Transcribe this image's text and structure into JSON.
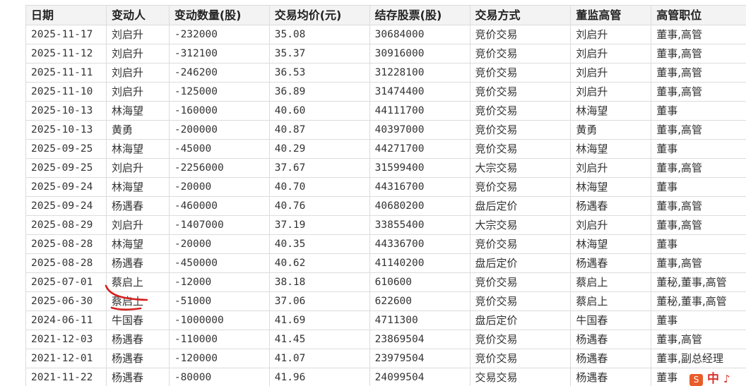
{
  "table": {
    "headers": [
      "日期",
      "变动人",
      "变动数量(股)",
      "交易均价(元)",
      "结存股票(股)",
      "交易方式",
      "董监高管",
      "高管职位"
    ],
    "rows": [
      [
        "2025-11-17",
        "刘启升",
        "-232000",
        "35.08",
        "30684000",
        "竞价交易",
        "刘启升",
        "董事,高管"
      ],
      [
        "2025-11-12",
        "刘启升",
        "-312100",
        "35.37",
        "30916000",
        "竞价交易",
        "刘启升",
        "董事,高管"
      ],
      [
        "2025-11-11",
        "刘启升",
        "-246200",
        "36.53",
        "31228100",
        "竞价交易",
        "刘启升",
        "董事,高管"
      ],
      [
        "2025-11-10",
        "刘启升",
        "-125000",
        "36.89",
        "31474400",
        "竞价交易",
        "刘启升",
        "董事,高管"
      ],
      [
        "2025-10-13",
        "林海望",
        "-160000",
        "40.60",
        "44111700",
        "竞价交易",
        "林海望",
        "董事"
      ],
      [
        "2025-10-13",
        "黄勇",
        "-200000",
        "40.87",
        "40397000",
        "竞价交易",
        "黄勇",
        "董事,高管"
      ],
      [
        "2025-09-25",
        "林海望",
        "-45000",
        "40.29",
        "44271700",
        "竞价交易",
        "林海望",
        "董事"
      ],
      [
        "2025-09-25",
        "刘启升",
        "-2256000",
        "37.67",
        "31599400",
        "大宗交易",
        "刘启升",
        "董事,高管"
      ],
      [
        "2025-09-24",
        "林海望",
        "-20000",
        "40.70",
        "44316700",
        "竞价交易",
        "林海望",
        "董事"
      ],
      [
        "2025-09-24",
        "杨遇春",
        "-460000",
        "40.76",
        "40680200",
        "盘后定价",
        "杨遇春",
        "董事,高管"
      ],
      [
        "2025-08-29",
        "刘启升",
        "-1407000",
        "37.19",
        "33855400",
        "大宗交易",
        "刘启升",
        "董事,高管"
      ],
      [
        "2025-08-28",
        "林海望",
        "-20000",
        "40.35",
        "44336700",
        "竞价交易",
        "林海望",
        "董事"
      ],
      [
        "2025-08-28",
        "杨遇春",
        "-450000",
        "40.62",
        "41140200",
        "盘后定价",
        "杨遇春",
        "董事,高管"
      ],
      [
        "2025-07-01",
        "蔡启上",
        "-12000",
        "38.18",
        "610600",
        "竞价交易",
        "蔡启上",
        "董秘,董事,高管"
      ],
      [
        "2025-06-30",
        "蔡启上",
        "-51000",
        "37.06",
        "622600",
        "竞价交易",
        "蔡启上",
        "董秘,董事,高管"
      ],
      [
        "2024-06-11",
        "牛国春",
        "-1000000",
        "41.69",
        "4711300",
        "盘后定价",
        "牛国春",
        "董事"
      ],
      [
        "2021-12-03",
        "杨遇春",
        "-110000",
        "41.45",
        "23869504",
        "竞价交易",
        "杨遇春",
        "董事,高管"
      ],
      [
        "2021-12-01",
        "杨遇春",
        "-120000",
        "41.07",
        "23979504",
        "竞价交易",
        "杨遇春",
        "董事,副总经理"
      ],
      [
        "2021-11-22",
        "杨遇春",
        "-80000",
        "41.96",
        "24099504",
        "交易交易",
        "杨遇春",
        "董事"
      ]
    ]
  },
  "annotation_color": "#d61f1f",
  "ime": {
    "logo": "S",
    "mode": "中",
    "punct": "♪"
  }
}
